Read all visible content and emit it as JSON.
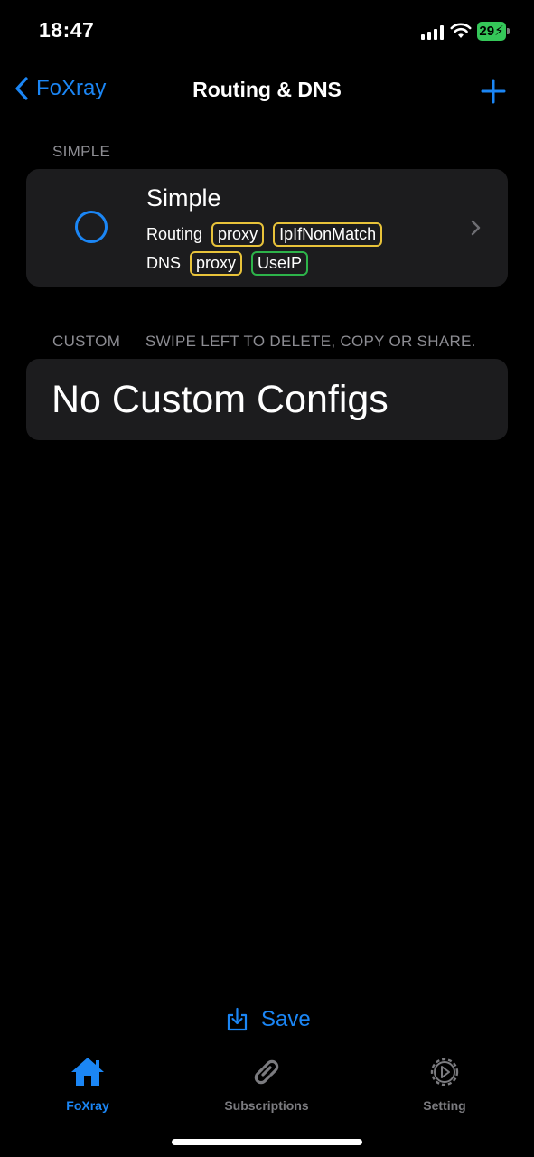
{
  "status_bar": {
    "time": "18:47",
    "battery": "29"
  },
  "nav": {
    "back_label": "FoXray",
    "title": "Routing & DNS"
  },
  "simple_section": {
    "header": "SIMPLE",
    "config": {
      "title": "Simple",
      "routing_label": "Routing",
      "routing_tags": [
        "proxy",
        "IpIfNonMatch"
      ],
      "dns_label": "DNS",
      "dns_tags": [
        "proxy",
        "UseIP"
      ]
    }
  },
  "custom_section": {
    "header": "CUSTOM",
    "hint": "SWIPE LEFT TO DELETE, COPY OR SHARE.",
    "empty_text": "No Custom Configs"
  },
  "save_label": "Save",
  "tabs": [
    {
      "label": "FoXray",
      "icon": "house-icon",
      "active": true
    },
    {
      "label": "Subscriptions",
      "icon": "link-icon",
      "active": false
    },
    {
      "label": "Setting",
      "icon": "gear-icon",
      "active": false
    }
  ],
  "colors": {
    "accent": "#1b86f5",
    "background": "#000000",
    "card": "#1c1c1e",
    "tag_yellow": "#e8c33a",
    "tag_green": "#2db34a",
    "battery": "#35c759"
  }
}
